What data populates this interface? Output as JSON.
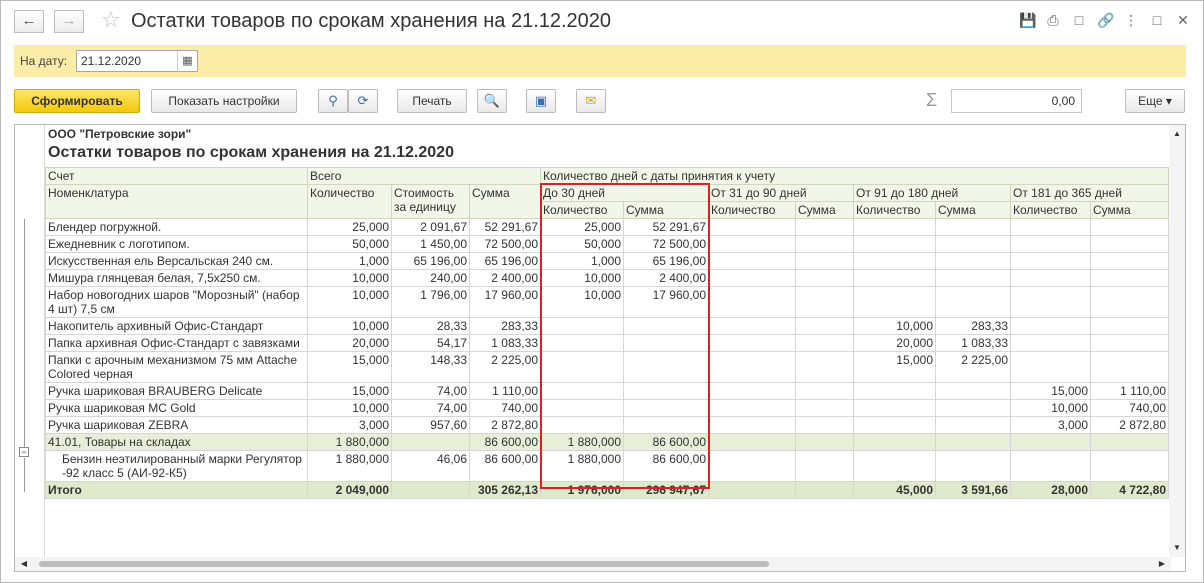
{
  "window": {
    "title": "Остатки товаров по срокам хранения на 21.12.2020"
  },
  "date_panel": {
    "label": "На дату:",
    "value": "21.12.2020"
  },
  "toolbar": {
    "generate": "Сформировать",
    "settings": "Показать настройки",
    "print": "Печать",
    "sum_value": "0,00",
    "more": "Еще ▾"
  },
  "report": {
    "organization": "ООО \"Петровские зори\"",
    "title": "Остатки товаров по срокам хранения на 21.12.2020",
    "headers": {
      "account": "Счет",
      "nomenclature": "Номенклатура",
      "total": "Всего",
      "qty": "Количество",
      "unit_cost": "Стоимость за единицу",
      "sum": "Сумма",
      "days": "Количество дней с даты принятия к учету",
      "d30": "До 30 дней",
      "d90": "От 31 до 90 дней",
      "d180": "От 91 до 180 дней",
      "d365": "От 181 до 365 дней"
    },
    "rows": [
      {
        "name": "Блендер погружной.",
        "q": "25,000",
        "c": "2 091,67",
        "s": "52 291,67",
        "q30": "25,000",
        "s30": "52 291,67",
        "q90": "",
        "s90": "",
        "q180": "",
        "s180": "",
        "q365": "",
        "s365": ""
      },
      {
        "name": "Ежедневник с логотипом.",
        "q": "50,000",
        "c": "1 450,00",
        "s": "72 500,00",
        "q30": "50,000",
        "s30": "72 500,00",
        "q90": "",
        "s90": "",
        "q180": "",
        "s180": "",
        "q365": "",
        "s365": ""
      },
      {
        "name": "Искусственная ель Версальская 240 см.",
        "q": "1,000",
        "c": "65 196,00",
        "s": "65 196,00",
        "q30": "1,000",
        "s30": "65 196,00",
        "q90": "",
        "s90": "",
        "q180": "",
        "s180": "",
        "q365": "",
        "s365": ""
      },
      {
        "name": "Мишура глянцевая белая, 7,5х250 см.",
        "q": "10,000",
        "c": "240,00",
        "s": "2 400,00",
        "q30": "10,000",
        "s30": "2 400,00",
        "q90": "",
        "s90": "",
        "q180": "",
        "s180": "",
        "q365": "",
        "s365": ""
      },
      {
        "name": "Набор новогодних шаров \"Морозный\" (набор 4 шт) 7,5 см",
        "q": "10,000",
        "c": "1 796,00",
        "s": "17 960,00",
        "q30": "10,000",
        "s30": "17 960,00",
        "q90": "",
        "s90": "",
        "q180": "",
        "s180": "",
        "q365": "",
        "s365": ""
      },
      {
        "name": "Накопитель архивный Офис-Стандарт",
        "q": "10,000",
        "c": "28,33",
        "s": "283,33",
        "q30": "",
        "s30": "",
        "q90": "",
        "s90": "",
        "q180": "10,000",
        "s180": "283,33",
        "q365": "",
        "s365": ""
      },
      {
        "name": "Папка архивная Офис-Стандарт с завязками",
        "q": "20,000",
        "c": "54,17",
        "s": "1 083,33",
        "q30": "",
        "s30": "",
        "q90": "",
        "s90": "",
        "q180": "20,000",
        "s180": "1 083,33",
        "q365": "",
        "s365": ""
      },
      {
        "name": "Папки с арочным механизмом 75 мм Attache Colored черная",
        "q": "15,000",
        "c": "148,33",
        "s": "2 225,00",
        "q30": "",
        "s30": "",
        "q90": "",
        "s90": "",
        "q180": "15,000",
        "s180": "2 225,00",
        "q365": "",
        "s365": ""
      },
      {
        "name": "Ручка шариковая BRAUBERG Delicate",
        "q": "15,000",
        "c": "74,00",
        "s": "1 110,00",
        "q30": "",
        "s30": "",
        "q90": "",
        "s90": "",
        "q180": "",
        "s180": "",
        "q365": "15,000",
        "s365": "1 110,00"
      },
      {
        "name": "Ручка шариковая MC Gold",
        "q": "10,000",
        "c": "74,00",
        "s": "740,00",
        "q30": "",
        "s30": "",
        "q90": "",
        "s90": "",
        "q180": "",
        "s180": "",
        "q365": "10,000",
        "s365": "740,00"
      },
      {
        "name": "Ручка шариковая ZEBRA",
        "q": "3,000",
        "c": "957,60",
        "s": "2 872,80",
        "q30": "",
        "s30": "",
        "q90": "",
        "s90": "",
        "q180": "",
        "s180": "",
        "q365": "3,000",
        "s365": "2 872,80"
      }
    ],
    "group": {
      "name": "41.01, Товары на складах",
      "q": "1 880,000",
      "c": "",
      "s": "86 600,00",
      "q30": "1 880,000",
      "s30": "86 600,00"
    },
    "group_rows": [
      {
        "name": "Бензин неэтилированный марки Регулятор -92 класс 5 (АИ-92-К5)",
        "q": "1 880,000",
        "c": "46,06",
        "s": "86 600,00",
        "q30": "1 880,000",
        "s30": "86 600,00"
      }
    ],
    "total": {
      "label": "Итого",
      "q": "2 049,000",
      "s": "305 262,13",
      "q30": "1 976,000",
      "s30": "296 947,67",
      "q180": "45,000",
      "s180": "3 591,66",
      "q365": "28,000",
      "s365": "4 722,80"
    }
  }
}
